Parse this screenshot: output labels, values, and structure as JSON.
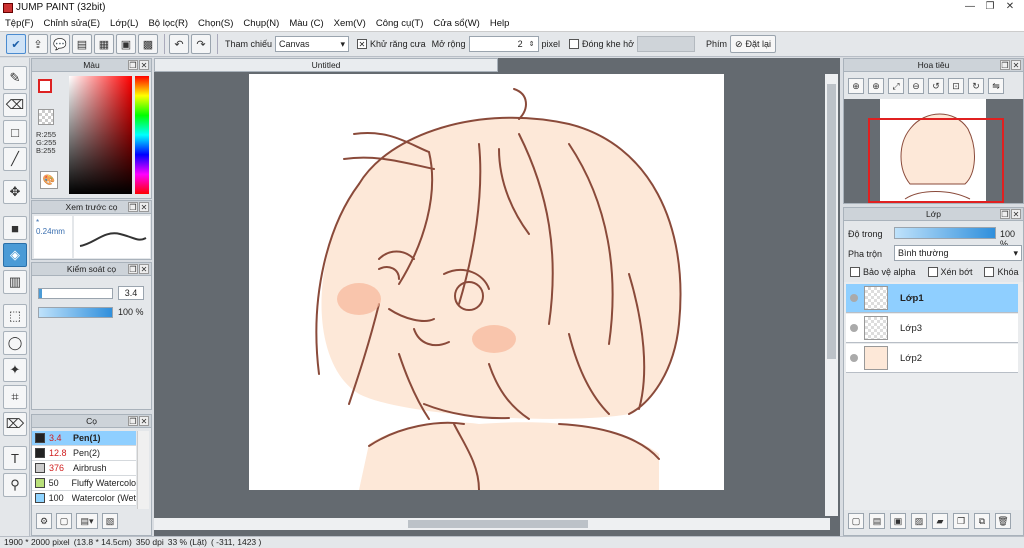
{
  "window": {
    "title": "JUMP PAINT (32bit)",
    "minimize": "—",
    "maximize": "❐",
    "close": "✕"
  },
  "menu": [
    "Tệp(F)",
    "Chỉnh sửa(E)",
    "Lớp(L)",
    "Bộ lọc(R)",
    "Chọn(S)",
    "Chụp(N)",
    "Màu (C)",
    "Xem(V)",
    "Công cụ(T)",
    "Cửa sổ(W)",
    "Help"
  ],
  "toolbar": {
    "reference_label": "Tham chiếu",
    "reference_value": "Canvas",
    "antialias_label": "Khử răng cưa",
    "antialias_checked": "✕",
    "expand_label": "Mở rộng",
    "expand_value": "2",
    "expand_unit": "pixel",
    "close_gap_label": "Đóng khe hở",
    "key_label": "Phím",
    "reset_label": "Đặt lại"
  },
  "color_panel": {
    "title": "Màu",
    "r": "R:255",
    "g": "G:255",
    "b": "B:255"
  },
  "brush_preview": {
    "title": "Xem trước cọ",
    "size": "0.24mm"
  },
  "brush_control": {
    "title": "Kiểm soát cọ",
    "size_value": "3.4",
    "opacity_value": "100 %"
  },
  "brush_panel": {
    "title": "Cọ",
    "items": [
      {
        "size": "3.4",
        "name": "Pen(1)",
        "color": "#222222"
      },
      {
        "size": "12.8",
        "name": "Pen(2)",
        "color": "#222222"
      },
      {
        "size": "376",
        "name": "Airbrush",
        "color": "#cccccc"
      },
      {
        "size": "50",
        "name": "Fluffy Watercolor",
        "color": "#b9e07a"
      },
      {
        "size": "100",
        "name": "Watercolor (Wet)",
        "color": "#8fd4ff"
      }
    ]
  },
  "document": {
    "tab": "Untitled"
  },
  "navigator": {
    "title": "Hoa tiêu"
  },
  "layers_panel": {
    "title": "Lớp",
    "opacity_label": "Độ trong",
    "opacity_value": "100 %",
    "blend_label": "Pha trộn",
    "blend_value": "Bình thường",
    "protect_alpha": "Bảo vệ alpha",
    "clipping": "Xén bớt",
    "lock": "Khóa",
    "layers": [
      {
        "name": "Lớp1"
      },
      {
        "name": "Lớp3"
      },
      {
        "name": "Lớp2"
      }
    ]
  },
  "status": {
    "size": "1900 * 2000 pixel",
    "physical": "(13.8 * 14.5cm)",
    "dpi": "350 dpi",
    "zoom": "33 % (Lật)",
    "coords": "( -311, 1423 )"
  },
  "colors": {
    "accent": "#4b9bd6",
    "selected_row": "#8fcfff",
    "canvas_bg": "#646a70",
    "line_art": "#8a4a3a",
    "skin": "#fde8d8"
  }
}
